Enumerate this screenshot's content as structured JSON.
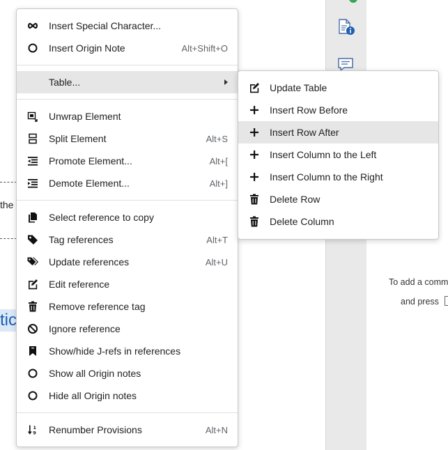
{
  "main_menu": {
    "items": [
      {
        "label": "Insert Special Character...",
        "shortcut": "",
        "icon": "infinity-icon"
      },
      {
        "label": "Insert Origin Note",
        "shortcut": "Alt+Shift+O",
        "icon": "circle-icon"
      },
      {
        "label": "Table...",
        "shortcut": "",
        "icon": "",
        "submenu": true
      },
      {
        "label": "Unwrap Element",
        "shortcut": "",
        "icon": "unwrap-icon"
      },
      {
        "label": "Split Element",
        "shortcut": "Alt+S",
        "icon": "split-icon"
      },
      {
        "label": "Promote Element...",
        "shortcut": "Alt+[",
        "icon": "outdent-icon"
      },
      {
        "label": "Demote Element...",
        "shortcut": "Alt+]",
        "icon": "indent-icon"
      },
      {
        "label": "Select reference to copy",
        "shortcut": "",
        "icon": "copy-icon"
      },
      {
        "label": "Tag references",
        "shortcut": "Alt+T",
        "icon": "tag-icon"
      },
      {
        "label": "Update references",
        "shortcut": "Alt+U",
        "icon": "tags-icon"
      },
      {
        "label": "Edit reference",
        "shortcut": "",
        "icon": "edit-icon"
      },
      {
        "label": "Remove reference tag",
        "shortcut": "",
        "icon": "trash-icon"
      },
      {
        "label": "Ignore reference",
        "shortcut": "",
        "icon": "ban-icon"
      },
      {
        "label": "Show/hide J-refs in references",
        "shortcut": "",
        "icon": "bookmark-icon"
      },
      {
        "label": "Show all Origin notes",
        "shortcut": "",
        "icon": "circle-icon"
      },
      {
        "label": "Hide all Origin notes",
        "shortcut": "",
        "icon": "circle-icon"
      },
      {
        "label": "Renumber Provisions",
        "shortcut": "Alt+N",
        "icon": "sort-numeric-icon"
      }
    ]
  },
  "sub_menu": {
    "items": [
      {
        "label": "Update Table",
        "icon": "edit-icon"
      },
      {
        "label": "Insert Row Before",
        "icon": "plus-icon"
      },
      {
        "label": "Insert Row After",
        "icon": "plus-icon"
      },
      {
        "label": "Insert Column to the Left",
        "icon": "plus-icon"
      },
      {
        "label": "Insert Column to the Right",
        "icon": "plus-icon"
      },
      {
        "label": "Delete Row",
        "icon": "trash-icon"
      },
      {
        "label": "Delete Column",
        "icon": "trash-icon"
      }
    ]
  },
  "background": {
    "text_the": "the",
    "text_tic": "tic",
    "hint_line1": "To add a comm",
    "hint_line2": "and press"
  },
  "colors": {
    "highlight": "#e6e6e6",
    "accent_blue": "#1a5fb4",
    "status_green": "#34a853"
  }
}
